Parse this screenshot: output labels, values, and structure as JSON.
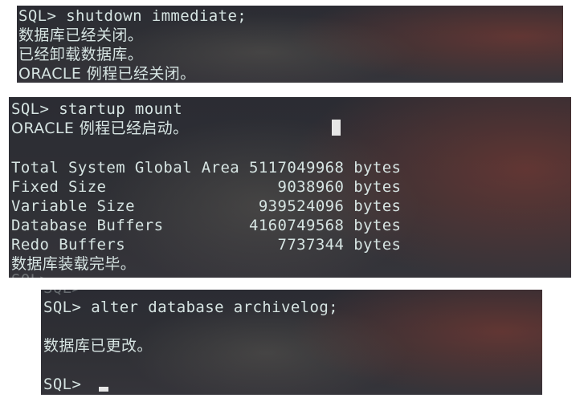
{
  "panel1": {
    "lines": [
      "SQL> shutdown immediate;",
      "数据库已经关闭。",
      "已经卸载数据库。",
      "ORACLE 例程已经关闭。"
    ]
  },
  "panel2": {
    "lines": [
      "SQL> startup mount",
      "ORACLE 例程已经启动。",
      "",
      "Total System Global Area 5117049968 bytes",
      "Fixed Size                  9038960 bytes",
      "Variable Size             939524096 bytes",
      "Database Buffers         4160749568 bytes",
      "Redo Buffers                7737344 bytes",
      "数据库装载完毕。"
    ],
    "cut_line": "SQL>"
  },
  "panel3": {
    "cut_line": "SQL>",
    "lines": [
      "SQL> alter database archivelog;",
      "",
      "数据库已更改。",
      "",
      "SQL> "
    ]
  }
}
